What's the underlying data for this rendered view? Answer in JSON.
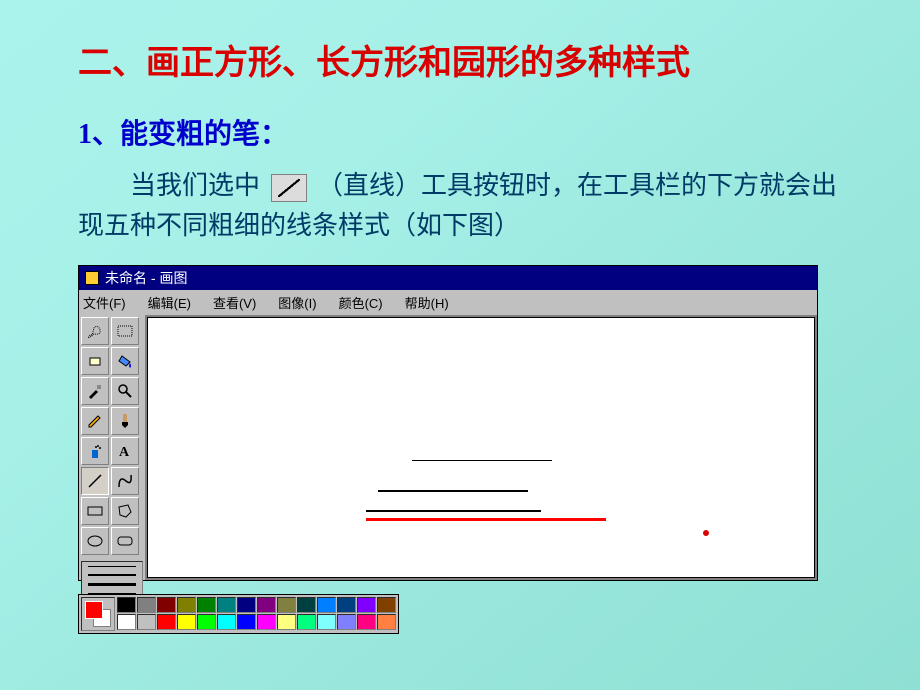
{
  "title": "二、画正方形、长方形和园形的多种样式",
  "subtitle": "1、能变粗的笔：",
  "body_before": "当我们选中",
  "body_after": "（直线）工具按钮时，在工具栏的下方就会出现五种不同粗细的线条样式（如下图）",
  "window": {
    "title": "未命名 - 画图",
    "menu": [
      "文件(F)",
      "编辑(E)",
      "查看(V)",
      "图像(I)",
      "颜色(C)",
      "帮助(H)"
    ]
  },
  "tools": [
    {
      "name": "free-select-icon"
    },
    {
      "name": "rect-select-icon"
    },
    {
      "name": "eraser-icon"
    },
    {
      "name": "fill-icon"
    },
    {
      "name": "dropper-icon"
    },
    {
      "name": "zoom-icon"
    },
    {
      "name": "pencil-icon"
    },
    {
      "name": "brush-icon"
    },
    {
      "name": "spray-icon"
    },
    {
      "name": "text-icon"
    },
    {
      "name": "line-icon"
    },
    {
      "name": "curve-icon"
    },
    {
      "name": "rect-icon"
    },
    {
      "name": "polygon-icon"
    },
    {
      "name": "ellipse-icon"
    },
    {
      "name": "roundrect-icon"
    }
  ],
  "palette_top": [
    "#000000",
    "#808080",
    "#800000",
    "#808000",
    "#008000",
    "#008080",
    "#000080",
    "#800080",
    "#808040",
    "#004040",
    "#0080ff",
    "#004080",
    "#8000ff",
    "#804000"
  ],
  "palette_bot": [
    "#ffffff",
    "#c0c0c0",
    "#ff0000",
    "#ffff00",
    "#00ff00",
    "#00ffff",
    "#0000ff",
    "#ff00ff",
    "#ffff80",
    "#00ff80",
    "#80ffff",
    "#8080ff",
    "#ff0080",
    "#ff8040"
  ]
}
